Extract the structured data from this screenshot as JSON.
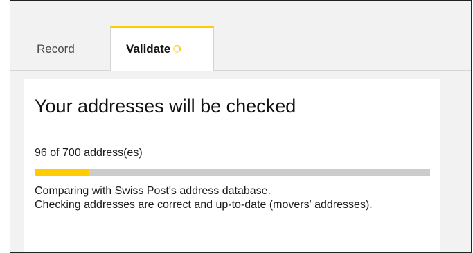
{
  "tabs": {
    "record_label": "Record",
    "validate_label": "Validate",
    "validate_status_icon": "loading-spinner-icon"
  },
  "card": {
    "title": "Your addresses will be checked",
    "checked_count": 96,
    "total_count": 700,
    "count_text": "96 of 700 address(es)",
    "progress_fraction": 0.137,
    "description_line1": "Comparing with Swiss Post's address database.",
    "description_line2": "Checking addresses are correct and up-to-date (movers' addresses)."
  },
  "colors": {
    "accent": "#ffcc00",
    "progress_track": "#cccccc",
    "background": "#f2f2f2"
  }
}
